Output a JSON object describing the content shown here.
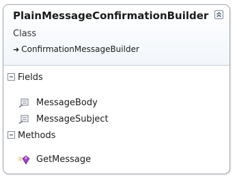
{
  "class_box": {
    "title": "PlainMessageConfirmationBuilder",
    "stereotype": "Class",
    "base_class": "ConfirmationMessageBuilder",
    "collapse_icon": "double-chevron-up-icon"
  },
  "sections": {
    "fields": {
      "label": "Fields",
      "items": [
        {
          "name": "MessageBody",
          "icon": "property-icon"
        },
        {
          "name": "MessageSubject",
          "icon": "property-icon"
        }
      ]
    },
    "methods": {
      "label": "Methods",
      "items": [
        {
          "name": "GetMessage",
          "icon": "method-icon"
        }
      ]
    }
  },
  "colors": {
    "border": "#9aa3ad",
    "method_icon": "#a042c8"
  }
}
